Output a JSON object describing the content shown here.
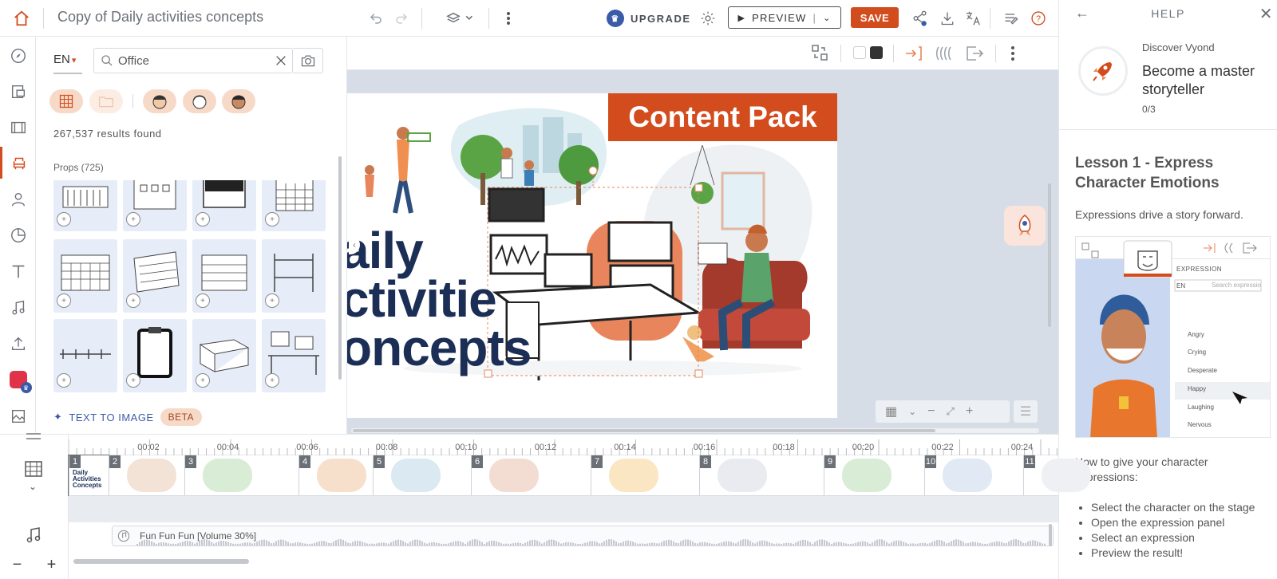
{
  "header": {
    "title": "Copy of Daily activities concepts",
    "upgrade_label": "UPGRADE",
    "preview_label": "PREVIEW",
    "save_label": "SAVE"
  },
  "library": {
    "language": "EN",
    "search_value": "Office",
    "results": "267,537 results found",
    "props_label": "Props (725)",
    "text_to_image": "TEXT TO IMAGE",
    "beta": "BETA"
  },
  "stage": {
    "content_pack": "Content Pack",
    "title_lines": [
      "aily",
      "ctivitie",
      "oncepts"
    ]
  },
  "help": {
    "title": "HELP",
    "discover_label": "Discover Vyond",
    "discover_title": "Become a master storyteller",
    "discover_progress": "0/3",
    "lesson_title": "Lesson 1 - Express Character Emotions",
    "lesson_subtitle": "Expressions drive a story forward.",
    "howto": "How to give your character expressions:",
    "steps": [
      "Select the character on the stage",
      "Open the expression panel",
      "Select an expression",
      "Preview the result!"
    ],
    "illustration": {
      "panel_title": "EXPRESSION",
      "lang": "EN",
      "search_placeholder": "Search expressio",
      "expressions": [
        "Angry",
        "Crying",
        "Desperate",
        "Happy",
        "Laughing",
        "Nervous"
      ],
      "selected": "Happy"
    }
  },
  "timeline": {
    "ticks": [
      "00:02",
      "00:04",
      "00:06",
      "00:08",
      "00:10",
      "00:12",
      "00:14",
      "00:16",
      "00:18",
      "00:20",
      "00:22",
      "00:24"
    ],
    "scenes": [
      "1",
      "2",
      "3",
      "4",
      "5",
      "6",
      "7",
      "8",
      "9",
      "10",
      "11"
    ],
    "scene1_label": "Daily Activities Concepts",
    "audio_label": "Fun Fun Fun [Volume 30%]"
  },
  "colors": {
    "accent": "#d24c1e",
    "brand_blue": "#3b5ba8",
    "navy": "#1b2e55"
  }
}
